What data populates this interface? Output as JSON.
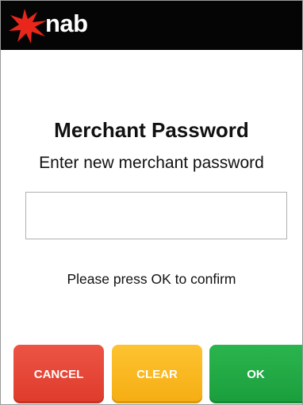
{
  "header": {
    "brand": "nab",
    "logo_icon": "nab-star-icon",
    "background": "#050505",
    "star_color": "#e8261c"
  },
  "main": {
    "title": "Merchant Password",
    "subtitle": "Enter new merchant password",
    "password_value": "",
    "hint": "Please press OK to confirm"
  },
  "buttons": {
    "cancel": {
      "label": "CANCEL",
      "color": "#e2402f"
    },
    "clear": {
      "label": "CLEAR",
      "color": "#f9b61f"
    },
    "ok": {
      "label": "OK",
      "color": "#22aa45"
    }
  }
}
